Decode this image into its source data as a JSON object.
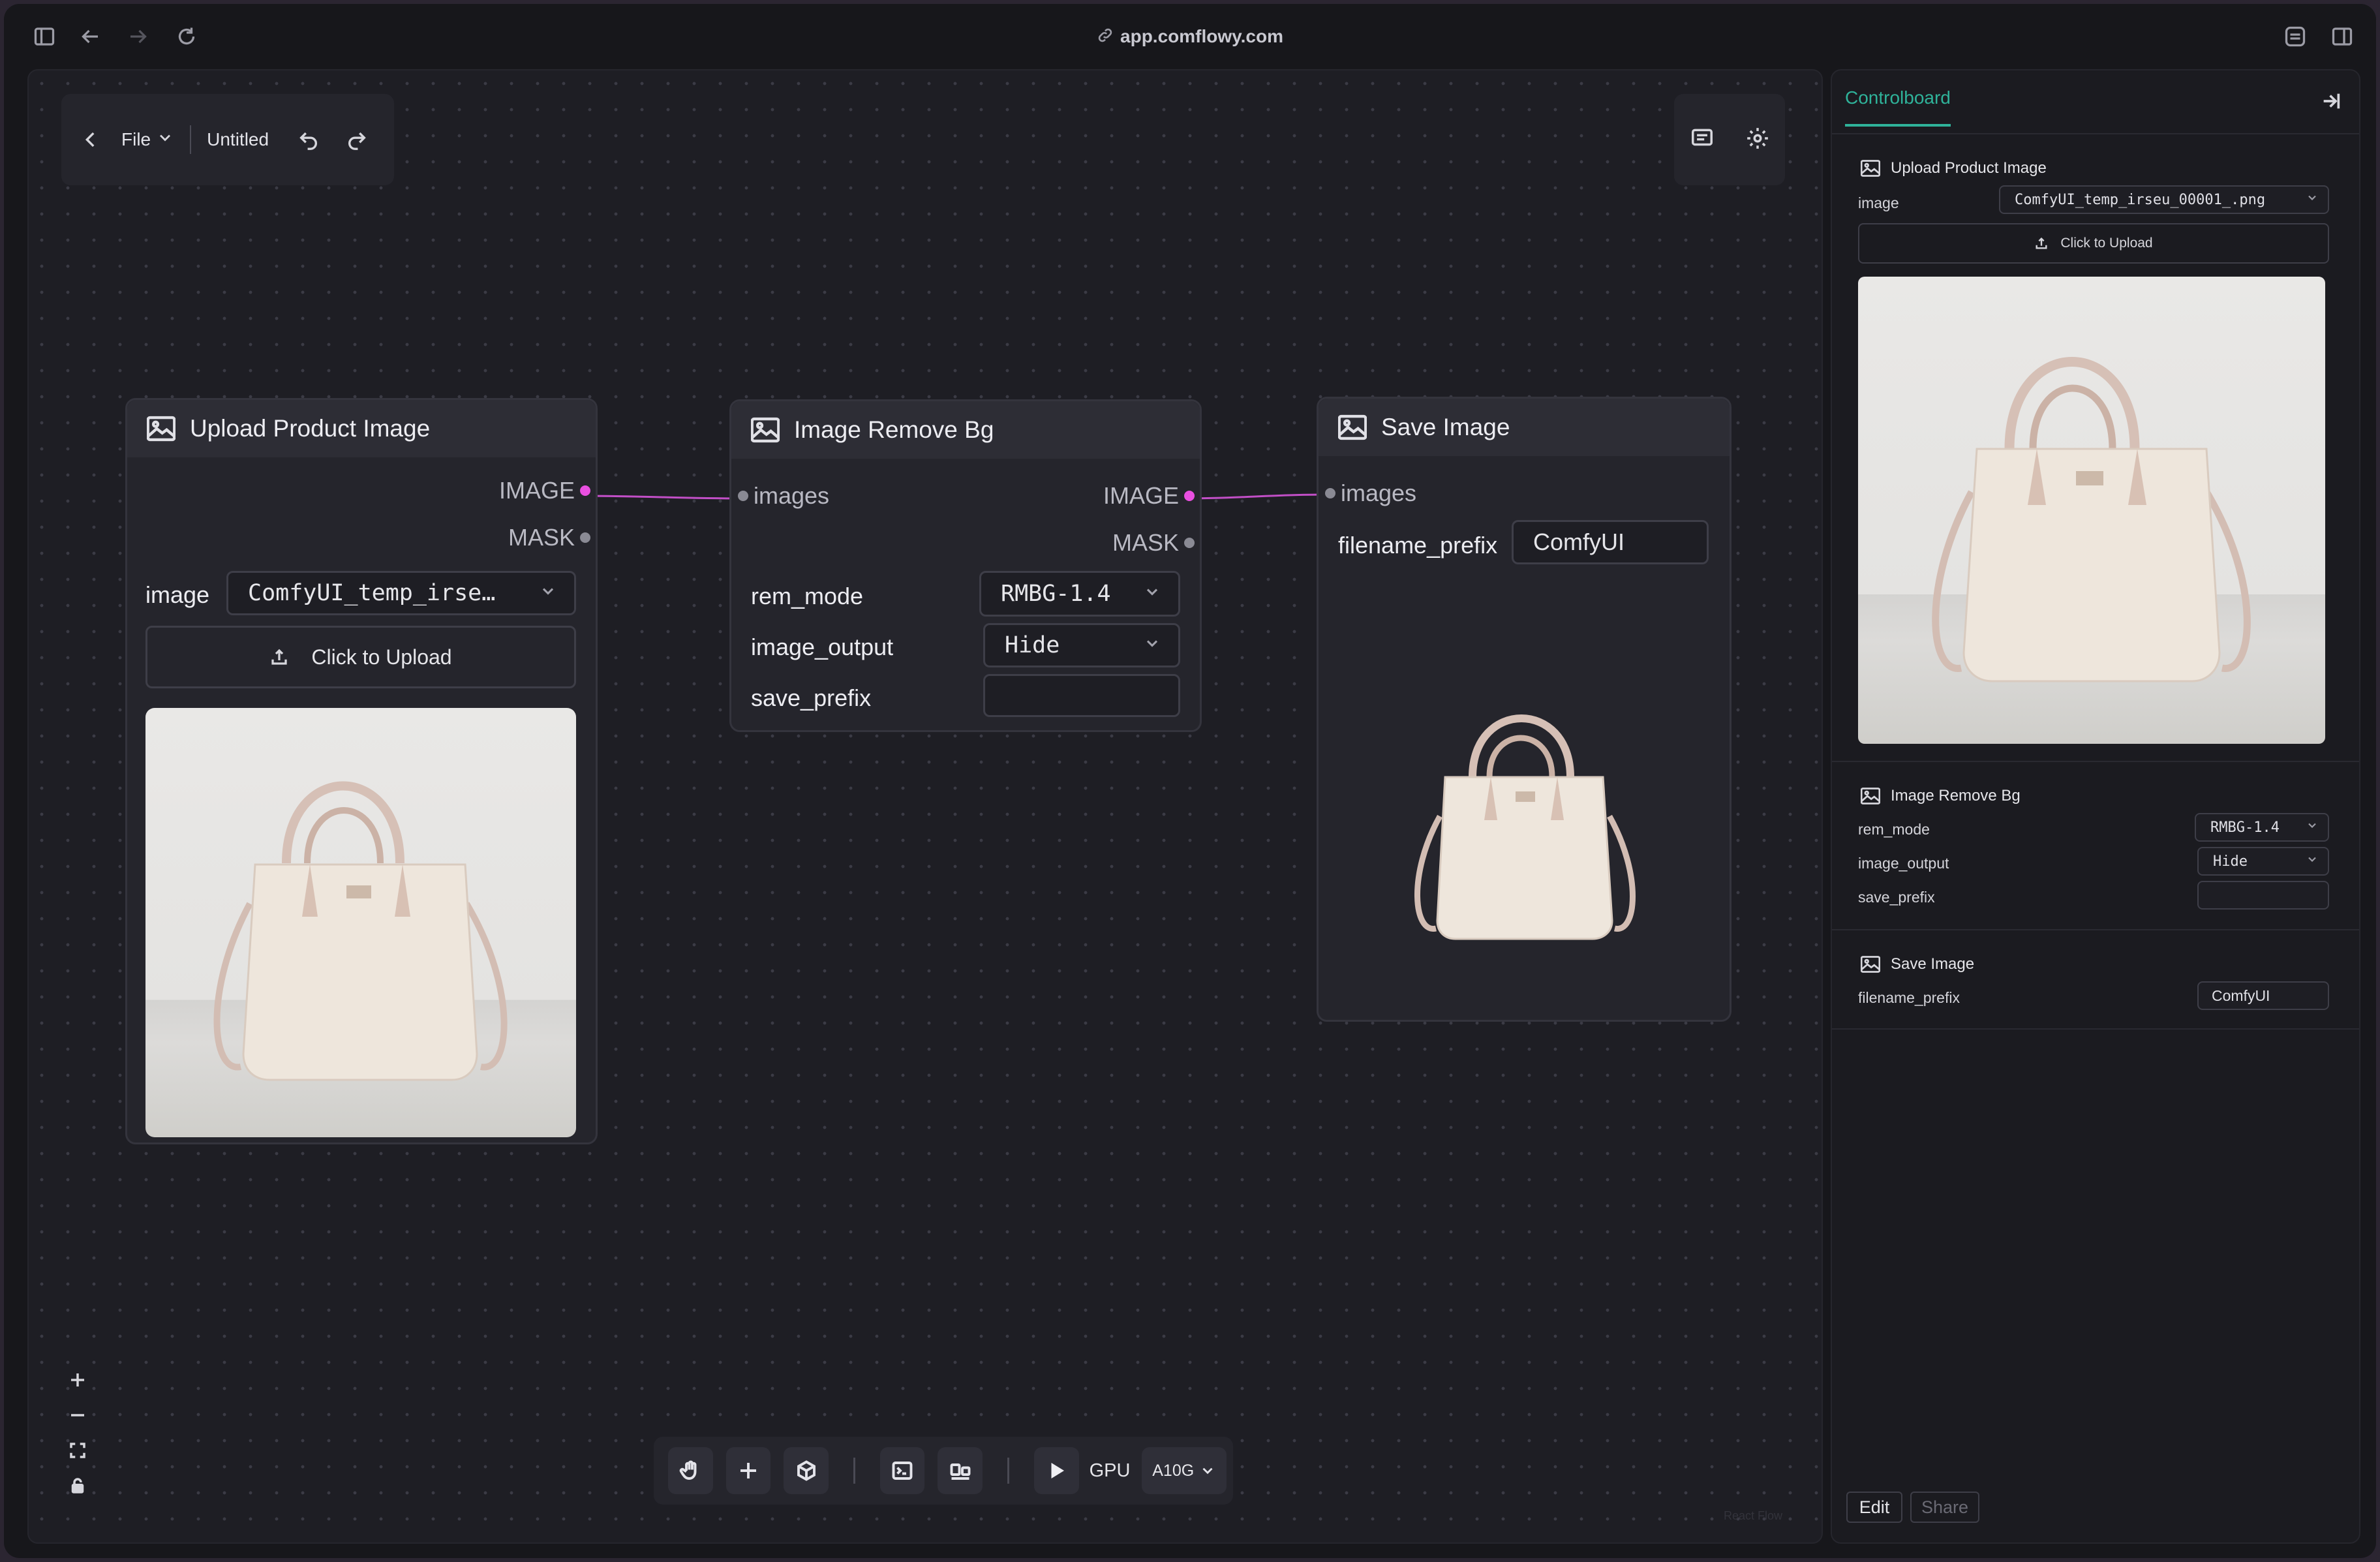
{
  "browser": {
    "url": "app.comflowy.com"
  },
  "toolbar": {
    "file_label": "File",
    "doc_title": "Untitled"
  },
  "nodes": {
    "upload": {
      "title": "Upload Product Image",
      "out_image": "IMAGE",
      "out_mask": "MASK",
      "image_label": "image",
      "image_value": "ComfyUI_temp_irse…",
      "upload_label": "Click to Upload"
    },
    "remove_bg": {
      "title": "Image Remove Bg",
      "in_images": "images",
      "out_image": "IMAGE",
      "out_mask": "MASK",
      "rem_mode_label": "rem_mode",
      "rem_mode_value": "RMBG-1.4",
      "image_output_label": "image_output",
      "image_output_value": "Hide",
      "save_prefix_label": "save_prefix",
      "save_prefix_value": ""
    },
    "save": {
      "title": "Save Image",
      "in_images": "images",
      "filename_prefix_label": "filename_prefix",
      "filename_prefix_value": "ComfyUI"
    }
  },
  "bottombar": {
    "gpu_label": "GPU",
    "gpu_value": "A10G"
  },
  "watermark": "React Flow",
  "panel": {
    "tab": "Controlboard",
    "upload": {
      "title": "Upload Product Image",
      "image_label": "image",
      "image_value": "ComfyUI_temp_irseu_00001_.png",
      "upload_label": "Click to Upload"
    },
    "remove_bg": {
      "title": "Image Remove Bg",
      "rem_mode_label": "rem_mode",
      "rem_mode_value": "RMBG-1.4",
      "image_output_label": "image_output",
      "image_output_value": "Hide",
      "save_prefix_label": "save_prefix",
      "save_prefix_value": ""
    },
    "save": {
      "title": "Save Image",
      "filename_prefix_label": "filename_prefix",
      "filename_prefix_value": "ComfyUI"
    },
    "edit_label": "Edit",
    "share_label": "Share"
  },
  "colors": {
    "accent": "#2fb39a",
    "edge": "#d24fcf",
    "port_active": "#e94fe0"
  },
  "icons": [
    "sidebar-toggle-icon",
    "back-icon",
    "forward-icon",
    "reload-icon",
    "link-icon",
    "extension-icon",
    "split-view-icon",
    "chevron-left-icon",
    "chevron-down-icon",
    "undo-icon",
    "redo-icon",
    "messages-icon",
    "gear-icon",
    "image-icon",
    "upload-icon",
    "zoom-in-icon",
    "zoom-out-icon",
    "fit-view-icon",
    "lock-icon",
    "hand-icon",
    "plus-icon",
    "cube-icon",
    "terminal-icon",
    "layout-icon",
    "play-icon",
    "collapse-panel-icon"
  ]
}
